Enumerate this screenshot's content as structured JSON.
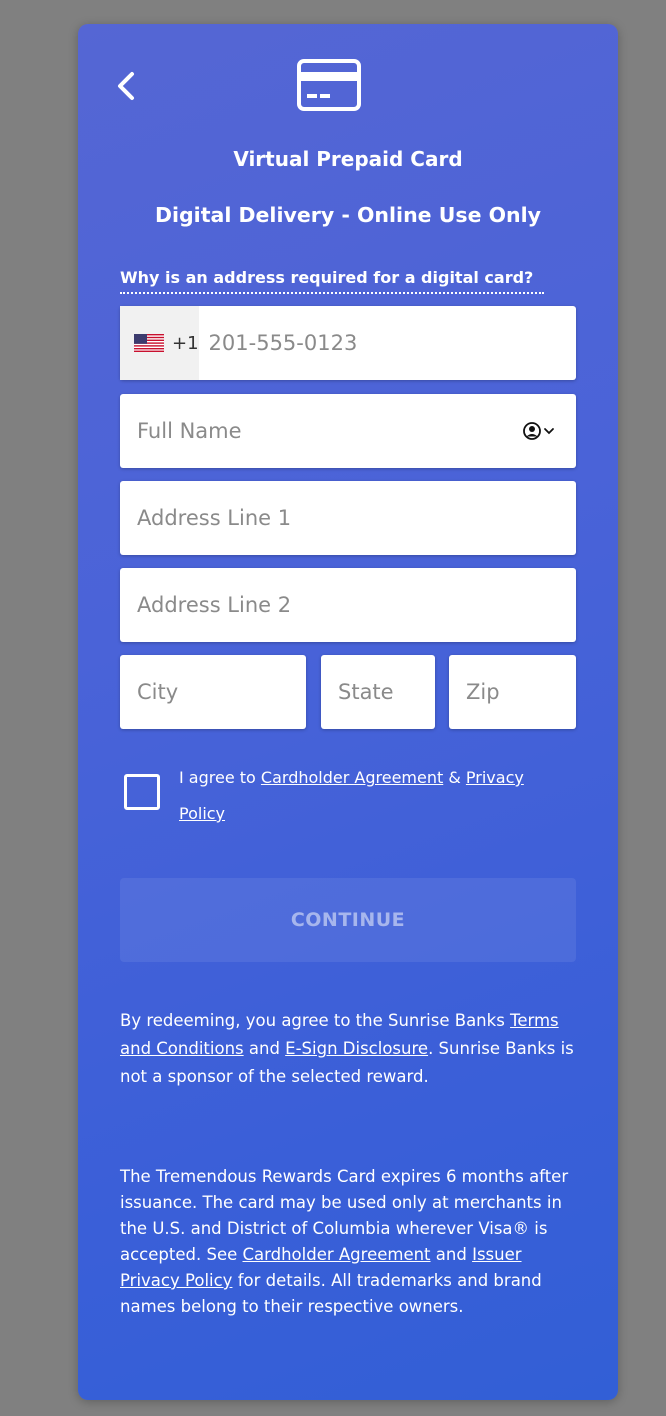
{
  "header": {
    "back_icon": "chevron-left-icon",
    "card_icon": "credit-card-icon",
    "title": "Virtual Prepaid Card",
    "subtitle": "Digital Delivery - Online Use Only",
    "why_link": "Why is an address required for a digital card?"
  },
  "form": {
    "phone": {
      "country_flag": "us-flag-icon",
      "country_code": "+1",
      "placeholder": "201-555-0123",
      "value": ""
    },
    "full_name": {
      "placeholder": "Full Name",
      "value": "",
      "icon": "person-circle-icon"
    },
    "address1": {
      "placeholder": "Address Line 1",
      "value": ""
    },
    "address2": {
      "placeholder": "Address Line 2",
      "value": ""
    },
    "city": {
      "placeholder": "City",
      "value": ""
    },
    "state": {
      "placeholder": "State",
      "value": ""
    },
    "zip": {
      "placeholder": "Zip",
      "value": ""
    },
    "agree": {
      "checked": false,
      "prefix": "I agree to ",
      "link1": "Cardholder Agreement",
      "mid": " & ",
      "link2": "Privacy Policy"
    },
    "continue_label": "CONTINUE"
  },
  "disclaimer1": {
    "a": "By redeeming, you agree to the Sunrise Banks ",
    "link1": "Terms and Conditions",
    "b": " and ",
    "link2": "E-Sign Disclosure",
    "c": ". Sunrise Banks is not a sponsor of the selected reward."
  },
  "disclaimer2": {
    "a": "The Tremendous Rewards Card expires 6 months after issuance. The card may be used only at merchants in the U.S. and District of Columbia wherever Visa® is accepted. See ",
    "link1": "Cardholder Agreement",
    "b": " and ",
    "link2": "Issuer Privacy Policy",
    "c": " for details. All trademarks and brand names belong to their respective owners."
  },
  "colors": {
    "background": "#808080",
    "card_gradient_start": "#5566d4",
    "card_gradient_end": "#325fd6",
    "text": "#ffffff"
  }
}
